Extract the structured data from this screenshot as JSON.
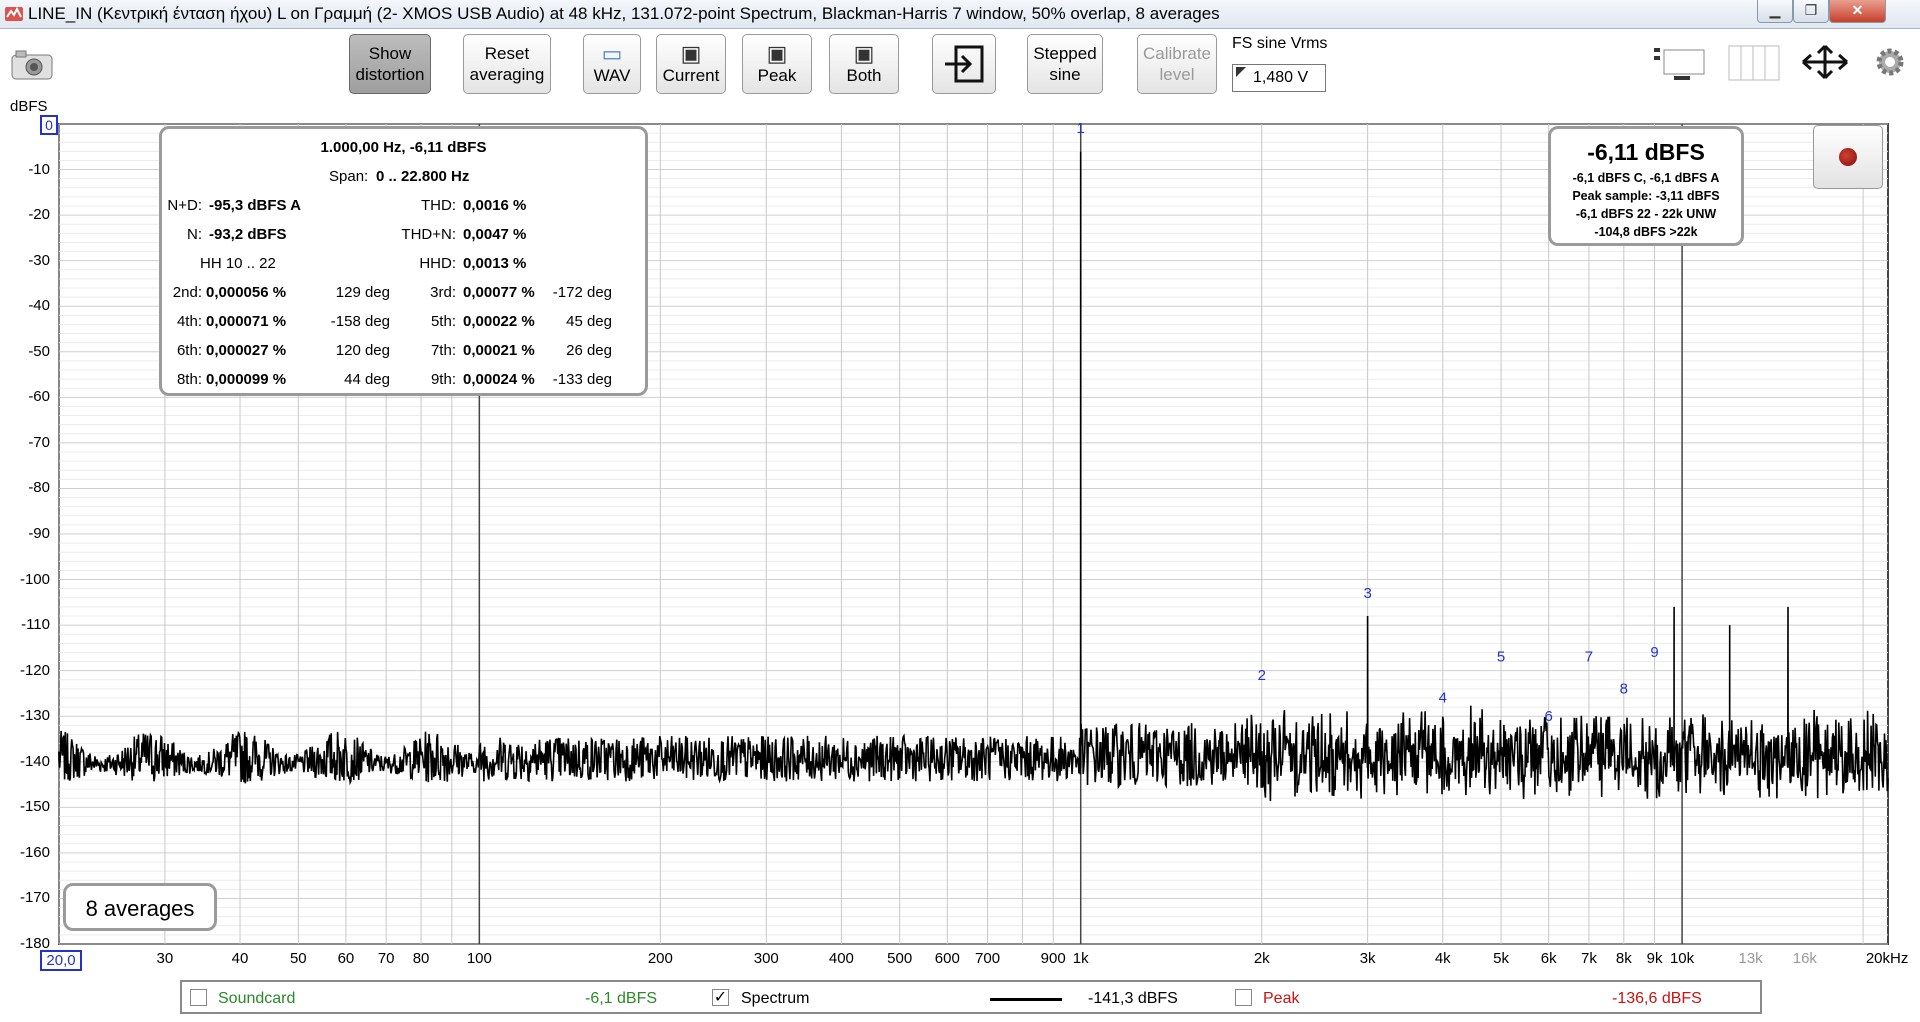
{
  "window": {
    "title": "LINE_IN (Κεντρική ένταση ήχου) L on Γραμμή (2- XMOS USB Audio) at 48 kHz, 131.072-point Spectrum, Blackman-Harris 7 window, 50% overlap, 8 averages",
    "minimize": "▁",
    "maximize": "❐",
    "close": "✕"
  },
  "toolbar": {
    "show_distortion_line1": "Show",
    "show_distortion_line2": "distortion",
    "reset_line1": "Reset",
    "reset_line2": "averaging",
    "wav": "WAV",
    "current": "Current",
    "peak": "Peak",
    "both": "Both",
    "stepped_line1": "Stepped",
    "stepped_line2": "sine",
    "calibrate_line1": "Calibrate",
    "calibrate_line2": "level",
    "fs_label": "FS sine Vrms",
    "fs_value": "1,480 V"
  },
  "info": {
    "header": "1.000,00 Hz, -6,11 dBFS",
    "span_label": "Span:",
    "span_value": "0 .. 22.800 Hz",
    "nd_label": "N+D:",
    "nd_value": "-95,3 dBFS A",
    "thd_label": "THD:",
    "thd_value": "0,0016 %",
    "n_label": "N:",
    "n_value": "-93,2 dBFS",
    "thdn_label": "THD+N:",
    "thdn_value": "0,0047 %",
    "hh_label": "HH 10 .. 22",
    "hhd_label": "HHD:",
    "hhd_value": "0,0013 %",
    "harmonics": [
      {
        "l1": "2nd:",
        "v1": "0,000056 %",
        "d1": "129 deg",
        "l2": "3rd:",
        "v2": "0,00077 %",
        "d2": "-172 deg"
      },
      {
        "l1": "4th:",
        "v1": "0,000071 %",
        "d1": "-158 deg",
        "l2": "5th:",
        "v2": "0,00022 %",
        "d2": "45 deg"
      },
      {
        "l1": "6th:",
        "v1": "0,000027 %",
        "d1": "120 deg",
        "l2": "7th:",
        "v2": "0,00021 %",
        "d2": "26 deg"
      },
      {
        "l1": "8th:",
        "v1": "0,000099 %",
        "d1": "44 deg",
        "l2": "9th:",
        "v2": "0,00024 %",
        "d2": "-133 deg"
      }
    ]
  },
  "level_panel": {
    "main": "-6,11 dBFS",
    "line1": "-6,1 dBFS C, -6,1 dBFS A",
    "line2": "Peak sample: -3,11 dBFS",
    "line3": "-6,1 dBFS 22 - 22k UNW",
    "line4": "-104,8 dBFS >22k"
  },
  "averages_label": "8 averages",
  "legend": {
    "soundcard": "Soundcard",
    "soundcard_value": "-6,1 dBFS",
    "spectrum": "Spectrum",
    "spectrum_value": "-141,3 dBFS",
    "peak": "Peak",
    "peak_value": "-136,6 dBFS",
    "spectrum_checked": "✓",
    "soundcard_color": "#2a8a2a",
    "peak_color": "#cc1111"
  },
  "chart_data": {
    "type": "line",
    "ylabel": "dBFS",
    "xscale": "log",
    "xlim": [
      20,
      22000
    ],
    "ylim": [
      -180,
      0
    ],
    "y_ticks": [
      "0",
      "-10",
      "-20",
      "-30",
      "-40",
      "-50",
      "-60",
      "-70",
      "-80",
      "-90",
      "-100",
      "-110",
      "-120",
      "-130",
      "-140",
      "-150",
      "-160",
      "-170",
      "-180"
    ],
    "x_ticks": [
      {
        "f": 20,
        "label": "20,0"
      },
      {
        "f": 30,
        "label": "30"
      },
      {
        "f": 40,
        "label": "40"
      },
      {
        "f": 50,
        "label": "50"
      },
      {
        "f": 60,
        "label": "60"
      },
      {
        "f": 70,
        "label": "70"
      },
      {
        "f": 80,
        "label": "80"
      },
      {
        "f": 100,
        "label": "100"
      },
      {
        "f": 200,
        "label": "200"
      },
      {
        "f": 300,
        "label": "300"
      },
      {
        "f": 400,
        "label": "400"
      },
      {
        "f": 500,
        "label": "500"
      },
      {
        "f": 600,
        "label": "600"
      },
      {
        "f": 700,
        "label": "700"
      },
      {
        "f": 900,
        "label": "900"
      },
      {
        "f": 1000,
        "label": "1k"
      },
      {
        "f": 2000,
        "label": "2k"
      },
      {
        "f": 3000,
        "label": "3k"
      },
      {
        "f": 4000,
        "label": "4k"
      },
      {
        "f": 5000,
        "label": "5k"
      },
      {
        "f": 6000,
        "label": "6k"
      },
      {
        "f": 7000,
        "label": "7k"
      },
      {
        "f": 8000,
        "label": "8k"
      },
      {
        "f": 9000,
        "label": "9k"
      },
      {
        "f": 10000,
        "label": "10k"
      },
      {
        "f": 13000,
        "label": "13k"
      },
      {
        "f": 16000,
        "label": "16k"
      },
      {
        "f": 20000,
        "label": "20kHz"
      }
    ],
    "series": [
      {
        "name": "Spectrum",
        "noise_floor": -141.3,
        "peaks": [
          {
            "f": 1000,
            "db": -6.1
          },
          {
            "f": 3000,
            "db": -108
          },
          {
            "f": 9700,
            "db": -106
          },
          {
            "f": 12000,
            "db": -110
          },
          {
            "f": 15000,
            "db": -106
          }
        ]
      }
    ],
    "harmonic_markers": [
      {
        "n": "1",
        "f": 1000,
        "db": -2
      },
      {
        "n": "2",
        "f": 2000,
        "db": -122
      },
      {
        "n": "3",
        "f": 3000,
        "db": -104
      },
      {
        "n": "4",
        "f": 4000,
        "db": -127
      },
      {
        "n": "5",
        "f": 5000,
        "db": -118
      },
      {
        "n": "6",
        "f": 6000,
        "db": -131
      },
      {
        "n": "7",
        "f": 7000,
        "db": -118
      },
      {
        "n": "8",
        "f": 8000,
        "db": -125
      },
      {
        "n": "9",
        "f": 9000,
        "db": -117
      }
    ]
  }
}
